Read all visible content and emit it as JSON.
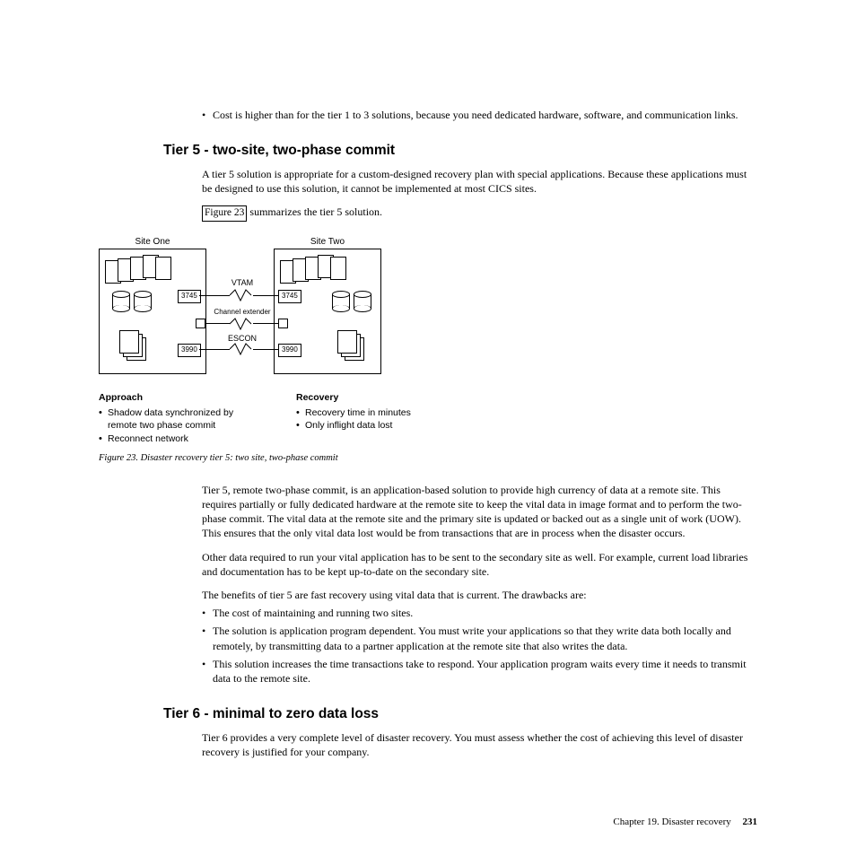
{
  "top_bullet": "Cost is higher than for the tier 1 to 3 solutions, because you need dedicated hardware, software, and communication links.",
  "tier5": {
    "heading": "Tier 5 - two-site, two-phase commit",
    "intro": "A tier 5 solution is appropriate for a custom-designed recovery plan with special applications. Because these applications must be designed to use this solution, it cannot be implemented at most CICS sites.",
    "figref_link": "Figure 23",
    "figref_after": " summarizes the tier 5 solution.",
    "para1": "Tier 5, remote two-phase commit, is an application-based solution to provide high currency of data at a remote site. This requires partially or fully dedicated hardware at the remote site to keep the vital data in image format and to perform the two-phase commit. The vital data at the remote site and the primary site is updated or backed out as a single unit of work (UOW). This ensures that the only vital data lost would be from transactions that are in process when the disaster occurs.",
    "para2": "Other data required to run your vital application has to be sent to the secondary site as well. For example, current load libraries and documentation has to be kept up-to-date on the secondary site.",
    "para3": "The benefits of tier 5 are fast recovery using vital data that is current. The drawbacks are:",
    "drawbacks": [
      "The cost of maintaining and running two sites.",
      "The solution is application program dependent. You must write your applications so that they write data both locally and remotely, by transmitting data to a partner application at the remote site that also writes the data.",
      "This solution increases the time transactions take to respond. Your application program waits every time it needs to transmit data to the remote site."
    ]
  },
  "tier6": {
    "heading": "Tier 6 - minimal to zero data loss",
    "para": "Tier 6 provides a very complete level of disaster recovery. You must assess whether the cost of achieving this level of disaster recovery is justified for your company."
  },
  "diagram": {
    "site1": "Site One",
    "site2": "Site Two",
    "vtam": "VTAM",
    "channel_ext": "Channel extender",
    "escon": "ESCON",
    "n3745": "3745",
    "n3990": "3990",
    "approach_head": "Approach",
    "approach_items": [
      "Shadow data synchronized by remote two phase commit",
      "Reconnect network"
    ],
    "recovery_head": "Recovery",
    "recovery_items": [
      "Recovery time in minutes",
      "Only inflight data lost"
    ],
    "caption": "Figure 23. Disaster recovery tier 5: two site, two-phase commit"
  },
  "footer": {
    "chapter": "Chapter 19. Disaster recovery",
    "page": "231"
  }
}
